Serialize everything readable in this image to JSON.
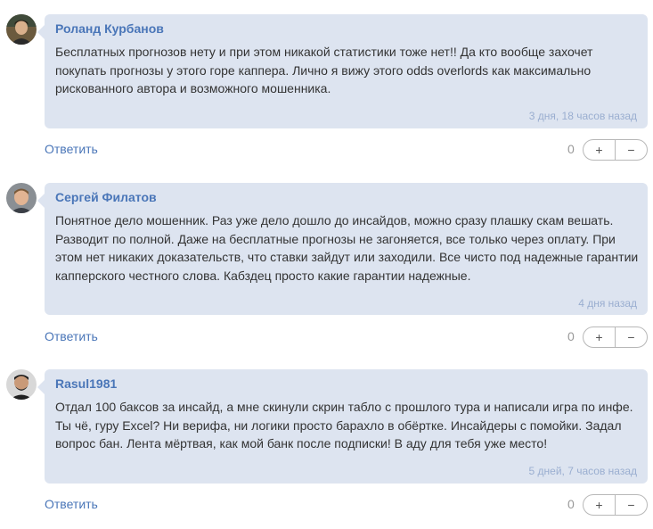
{
  "reply_label": "Ответить",
  "vote_up_label": "+",
  "vote_down_label": "−",
  "comments": [
    {
      "author": "Роланд Курбанов",
      "text": "Бесплатных прогнозов нету и при этом никакой статистики тоже нет!! Да кто вообще захочет покупать прогнозы у этого горе каппера. Лично я вижу этого odds overlords как максимально рискованного автора и возможного мошенника.",
      "time": "3 дня, 18 часов назад",
      "score": "0"
    },
    {
      "author": "Сергей Филатов",
      "text": "Понятное дело мошенник. Раз уже дело дошло до инсайдов, можно сразу плашку скам вешать. Разводит по полной. Даже на бесплатные прогнозы не загоняется, все только через оплату. При этом нет никаких доказательств, что ставки зайдут или заходили. Все чисто под надежные гарантии капперского честного слова. Кабздец просто какие гарантии надежные.",
      "time": "4 дня назад",
      "score": "0"
    },
    {
      "author": "Rasul1981",
      "text": "Отдал 100 баксов за инсайд, а мне скинули скрин табло с прошлого тура и написали игра по инфе. Ты чё, гуру Excel? Ни верифа, ни логики просто барахло в обёртке. Инсайдеры с помойки. Задал вопрос бан. Лента мёртвая, как мой банк после подписки! В аду для тебя уже место!",
      "time": "5 дней, 7 часов назад",
      "score": "0"
    }
  ]
}
